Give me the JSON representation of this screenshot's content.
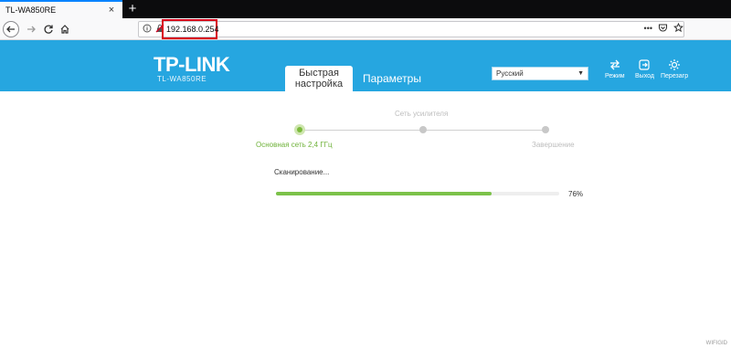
{
  "browser": {
    "tab_title": "TL-WA850RE",
    "tab_close": "×",
    "new_tab": "+",
    "url": "192.168.0.254",
    "url_menu": "•••"
  },
  "header": {
    "logo": "TP-LINK",
    "model": "TL-WA850RE",
    "tab_quick_line1": "Быстрая",
    "tab_quick_line2": "настройка",
    "tab_params": "Параметры",
    "language": "Русский",
    "btn_mode": "Режим",
    "btn_exit": "Выход",
    "btn_reboot": "Перезагр"
  },
  "steps": {
    "top_label": "Сеть усилителя",
    "step1": "Основная сеть 2,4 ГГц",
    "step3": "Завершение"
  },
  "scan": {
    "label": "Сканирование...",
    "progress": 0.76,
    "percent_text": "76%"
  },
  "watermark": "WIFIGID",
  "colors": {
    "brand": "#26a6e0",
    "accent_green": "#7cc24a",
    "highlight_red": "#d9001b"
  }
}
